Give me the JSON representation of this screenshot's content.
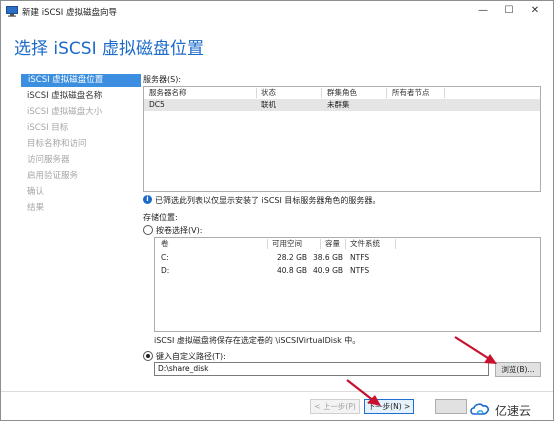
{
  "window": {
    "title": "新建 iSCSI 虚拟磁盘向导",
    "controls": {
      "minimize": "—",
      "maximize": "☐",
      "close": "✕"
    }
  },
  "heading": "选择 iSCSI 虚拟磁盘位置",
  "nav": {
    "items": [
      {
        "label": "iSCSI 虚拟磁盘位置",
        "state": "active"
      },
      {
        "label": "iSCSI 虚拟磁盘名称",
        "state": "enabled"
      },
      {
        "label": "iSCSI 虚拟磁盘大小",
        "state": "disabled"
      },
      {
        "label": "iSCSI 目标",
        "state": "disabled"
      },
      {
        "label": "目标名称和访问",
        "state": "disabled"
      },
      {
        "label": "访问服务器",
        "state": "disabled"
      },
      {
        "label": "启用验证服务",
        "state": "disabled"
      },
      {
        "label": "确认",
        "state": "disabled"
      },
      {
        "label": "结果",
        "state": "disabled"
      }
    ]
  },
  "servers": {
    "label": "服务器(S):",
    "columns": [
      "服务器名称",
      "状态",
      "群集角色",
      "所有者节点"
    ],
    "rows": [
      [
        "DC5",
        "联机",
        "未群集",
        ""
      ]
    ]
  },
  "info_text": "已筛选此列表以仅显示安装了 iSCSI 目标服务器角色的服务器。",
  "storage": {
    "label": "存储位置:",
    "by_volume_label": "按卷选择(V):",
    "volume_columns": [
      "卷",
      "可用空间",
      "容量",
      "文件系统"
    ],
    "volumes": [
      [
        "C:",
        "28.2 GB",
        "38.6 GB",
        "NTFS"
      ],
      [
        "D:",
        "40.8 GB",
        "40.9 GB",
        "NTFS"
      ]
    ],
    "note": "iSCSI 虚拟磁盘将保存在选定卷的 \\iSCSIVirtualDisk 中。",
    "custom_path_label": "键入自定义路径(T):",
    "custom_path_value": "D:\\share_disk",
    "browse_label": "浏览(B)...",
    "selected_option": "custom_path"
  },
  "footer": {
    "prev_label": "< 上一步(P)",
    "next_label": "下一步(N) >"
  },
  "watermark": "亿速云",
  "colors": {
    "accent": "#1b6ac9",
    "nav_active_bg": "#3c8fe0",
    "arrow": "#c8102e"
  }
}
